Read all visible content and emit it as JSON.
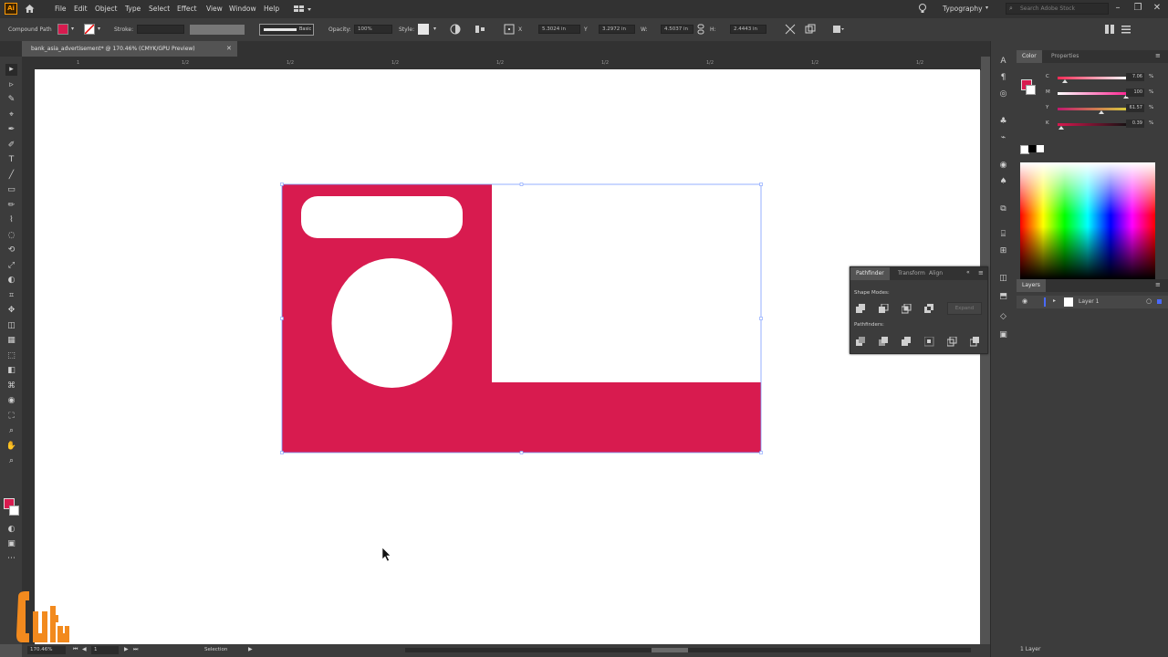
{
  "menu": {
    "logo": "Ai",
    "items": [
      "File",
      "Edit",
      "Object",
      "Type",
      "Select",
      "Effect",
      "View",
      "Window",
      "Help"
    ],
    "workspace": "Typography",
    "search_placeholder": "Search Adobe Stock"
  },
  "controlbar": {
    "selection_type": "Compound Path",
    "fill_color": "#d81b4f",
    "stroke_label": "Stroke:",
    "stroke_style": "Basic",
    "opacity_label": "Opacity:",
    "opacity_value": "100%",
    "style_label": "Style:",
    "x_value": "5.3024 in",
    "y_value": "3.2972 in",
    "w_label": "W:",
    "w_value": "4.5037 in",
    "h_label": "H:",
    "h_value": "2.4443 in"
  },
  "document": {
    "tab_title": "bank_asia_advertisement* @ 170.46% (CMYK/GPU Preview)",
    "ruler_ticks": [
      "1",
      "1/2",
      "1/2",
      "1/2",
      "1/2",
      "1/2",
      "1/2",
      "1/2",
      "1/2"
    ]
  },
  "artwork": {
    "card_color": "#d81b4f",
    "background": "#ffffff"
  },
  "statusbar": {
    "zoom": "170.46%",
    "artboard": "1",
    "tool_name": "Selection"
  },
  "color_panel": {
    "tabs": [
      "Color",
      "Properties"
    ],
    "sliders": [
      {
        "label": "C",
        "value": "7.06",
        "fraction": 0.07,
        "gradient": "linear-gradient(90deg,#ff2a55,#ffffff)"
      },
      {
        "label": "M",
        "value": "100",
        "fraction": 1.0,
        "gradient": "linear-gradient(90deg,#ffffff,#ff1f8f)"
      },
      {
        "label": "Y",
        "value": "61.57",
        "fraction": 0.62,
        "gradient": "linear-gradient(90deg,#c0186d,#d8d03a)"
      },
      {
        "label": "K",
        "value": "0.39",
        "fraction": 0.01,
        "gradient": "linear-gradient(90deg,#d8184f,#111111)"
      }
    ]
  },
  "layers_panel": {
    "tab": "Layers",
    "layer_name": "Layer 1",
    "footer": "1 Layer"
  },
  "pathfinder": {
    "tabs": [
      "Pathfinder",
      "Transform",
      "Align"
    ],
    "shape_modes_label": "Shape Modes:",
    "pathfinders_label": "Pathfinders:",
    "expand_label": "Expand"
  },
  "watermark": {
    "text": "Cuty"
  }
}
